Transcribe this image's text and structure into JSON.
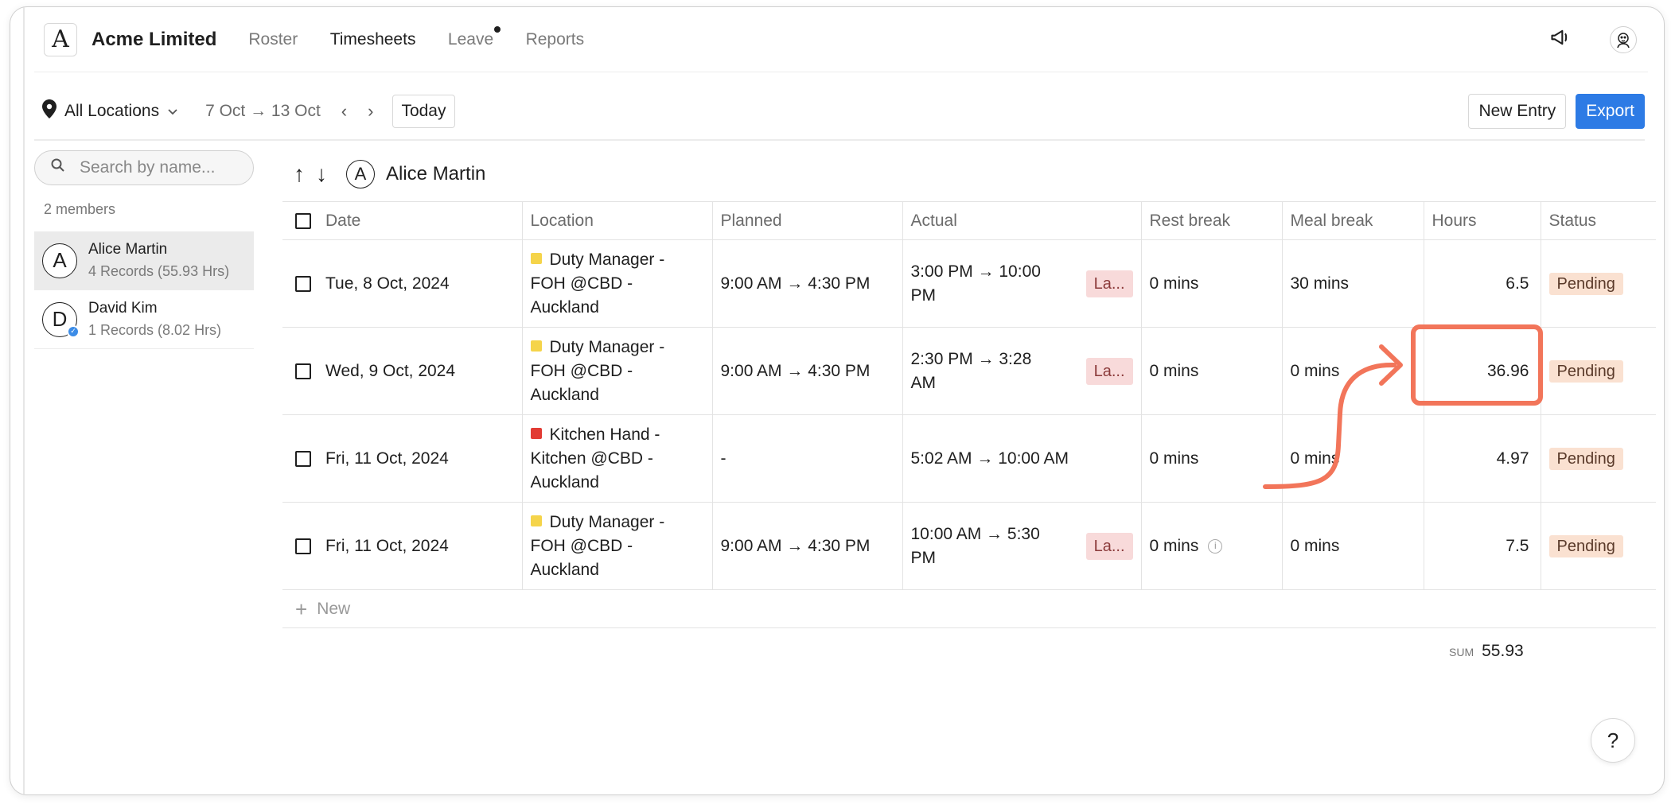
{
  "app": {
    "company": "Acme Limited",
    "logo_letter": "A"
  },
  "nav": {
    "items": [
      "Roster",
      "Timesheets",
      "Leave",
      "Reports"
    ],
    "active": "Timesheets"
  },
  "toolbar": {
    "location": "All Locations",
    "date_range": "7 Oct → 13 Oct",
    "prev": "‹",
    "next": "›",
    "today": "Today",
    "new_entry": "New Entry",
    "export": "Export"
  },
  "sidebar": {
    "search_placeholder": "Search by name...",
    "members_count": "2 members",
    "members": [
      {
        "initial": "A",
        "name": "Alice Martin",
        "sub": "4 Records (55.93 Hrs)"
      },
      {
        "initial": "D",
        "name": "David Kim",
        "sub": "1 Records (8.02 Hrs)"
      }
    ]
  },
  "main": {
    "selected_initial": "A",
    "selected_name": "Alice Martin",
    "columns": [
      "Date",
      "Location",
      "Planned",
      "Actual",
      "Rest break",
      "Meal break",
      "Hours",
      "Status"
    ],
    "rows": [
      {
        "date": "Tue, 8 Oct, 2024",
        "loc_line1": "Duty Manager -",
        "loc_line2": "FOH @CBD -",
        "loc_line3": "Auckland",
        "planned": "9:00 AM → 4:30 PM",
        "actual_line1": "3:00 PM → 10:00",
        "actual_line2": "PM",
        "late": "La...",
        "rest": "0 mins",
        "meal": "30 mins",
        "hours": "6.5",
        "status": "Pending"
      },
      {
        "date": "Wed, 9 Oct, 2024",
        "loc_line1": "Duty Manager -",
        "loc_line2": "FOH @CBD -",
        "loc_line3": "Auckland",
        "planned": "9:00 AM → 4:30 PM",
        "actual_line1": "2:30 PM → 3:28",
        "actual_line2": "AM",
        "late": "La...",
        "rest": "0 mins",
        "meal": "0 mins",
        "hours": "36.96",
        "status": "Pending"
      },
      {
        "date": "Fri, 11 Oct, 2024",
        "loc_line1": "Kitchen Hand -",
        "loc_line2": "Kitchen @CBD -",
        "loc_line3": "Auckland",
        "planned": "-",
        "actual_line1": "5:02 AM → 10:00 AM",
        "actual_line2": "",
        "late": "",
        "rest": "0 mins",
        "meal": "0 mins",
        "hours": "4.97",
        "status": "Pending"
      },
      {
        "date": "Fri, 11 Oct, 2024",
        "loc_line1": "Duty Manager -",
        "loc_line2": "FOH @CBD -",
        "loc_line3": "Auckland",
        "planned": "9:00 AM → 4:30 PM",
        "actual_line1": "10:00 AM → 5:30",
        "actual_line2": "PM",
        "late": "La...",
        "rest": "0 mins",
        "meal": "0 mins",
        "hours": "7.5",
        "status": "Pending"
      }
    ],
    "new_label": "New",
    "sum_label": "SUM",
    "sum_value": "55.93"
  },
  "help": "?",
  "colors": {
    "accent": "#2d7be5",
    "duty_manager": "#f5d44a",
    "kitchen_hand": "#e23b34",
    "annotation": "#f2755a"
  }
}
